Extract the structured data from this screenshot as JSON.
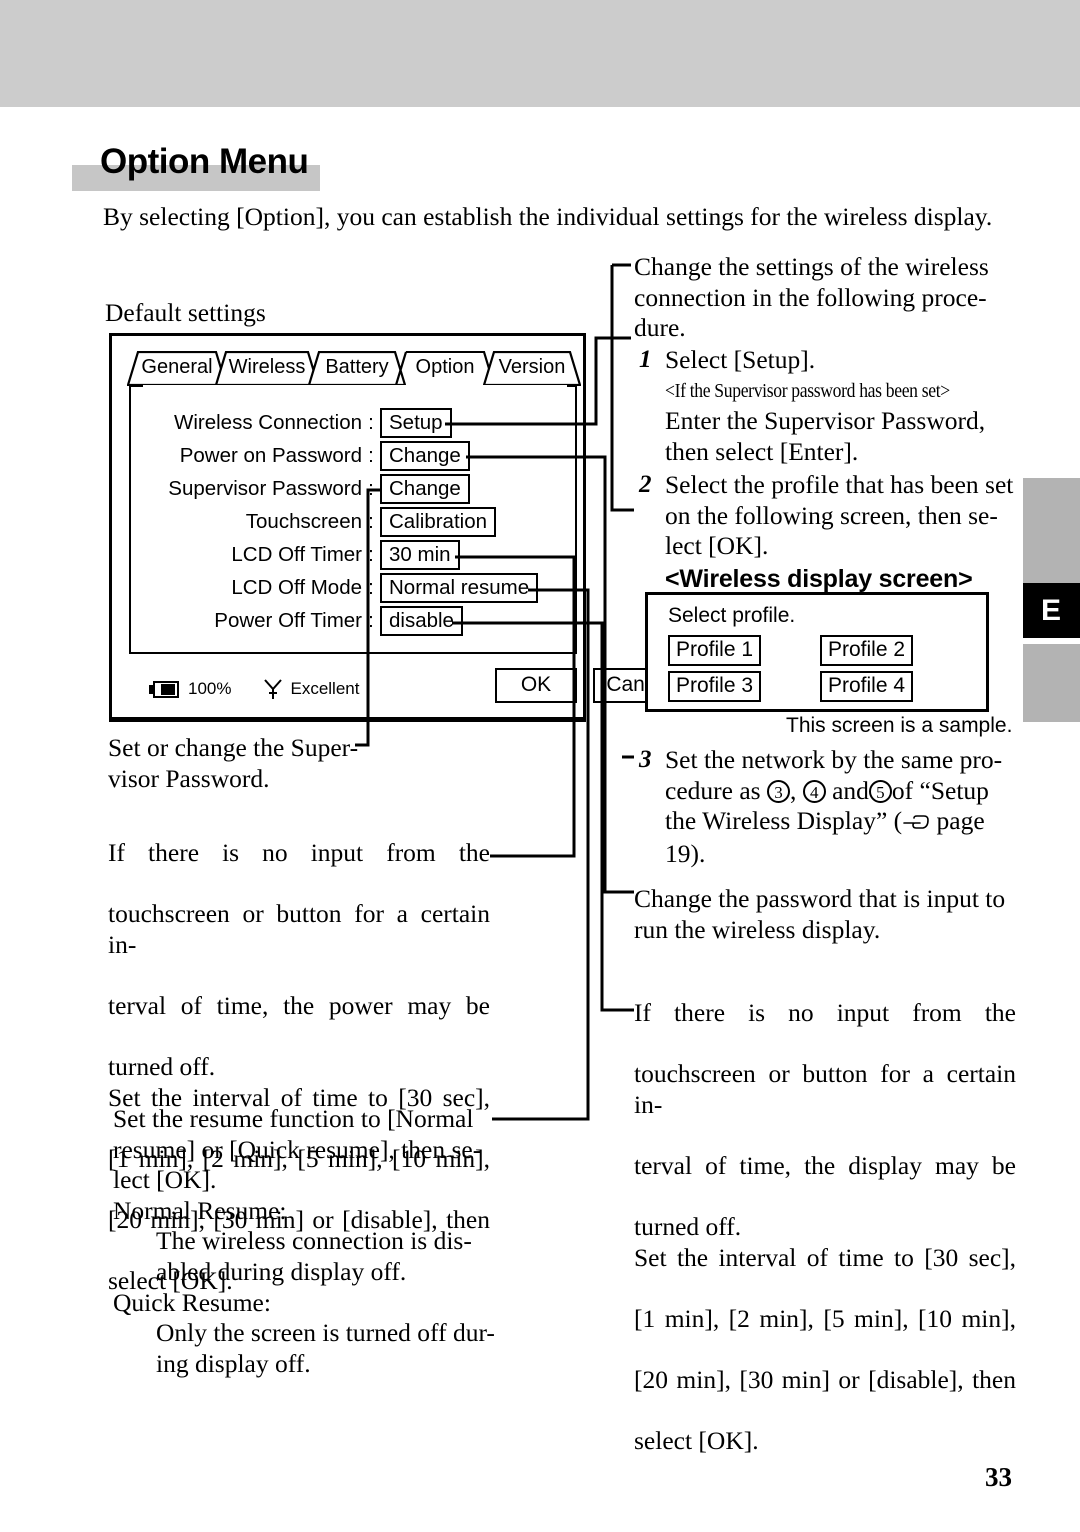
{
  "page": {
    "number": "33",
    "edge_tab_letter": "E",
    "title": "Option Menu",
    "intro": "By selecting [Option], you can establish the individual settings for the wireless display."
  },
  "left": {
    "default_settings_label": "Default settings",
    "dialog": {
      "tabs": [
        {
          "label": "General",
          "active": false
        },
        {
          "label": "Wireless",
          "active": false
        },
        {
          "label": "Battery",
          "active": false
        },
        {
          "label": "Option",
          "active": true
        },
        {
          "label": "Version",
          "active": false
        }
      ],
      "settings": [
        {
          "label": "Wireless Connection",
          "colon": ":",
          "value": "Setup"
        },
        {
          "label": "Power on Password",
          "colon": ":",
          "value": "Change"
        },
        {
          "label": "Supervisor Password",
          "colon": ":",
          "value": "Change"
        },
        {
          "label": "Touchscreen",
          "colon": ":",
          "value": "Calibration"
        },
        {
          "label": "LCD Off Timer",
          "colon": ":",
          "value": "30 min"
        },
        {
          "label": "LCD Off Mode",
          "colon": ":",
          "value": "Normal resume"
        },
        {
          "label": "Power Off Timer",
          "colon": ":",
          "value": "disable"
        }
      ],
      "status": {
        "battery_icon": "battery-icon",
        "battery_percent": "100%",
        "signal_icon": "antenna-icon",
        "signal_level": "Excellent"
      },
      "buttons": {
        "ok": "OK",
        "cancel": "Cancel"
      }
    },
    "notes": {
      "supervisor": "Set or change the Super-\nvisor Password.",
      "supervisor_l1": "Set or change the Super-",
      "supervisor_l2": "visor Password.",
      "power_off_1": "If there is no input from the",
      "power_off_2": "touchscreen or button for a certain in-",
      "power_off_3": "terval of time, the power may be",
      "power_off_4": "turned off.",
      "power_off_5": "Set the interval of time to [30 sec],",
      "power_off_6": "[1 min], [2 min], [5 min], [10 min],",
      "power_off_7": "[20 min], [30 min] or [disable], then",
      "power_off_8": "select [OK].",
      "resume_1": "Set the resume function to [Normal",
      "resume_2": "resume] or [Quick resume], then se-",
      "resume_3": "lect [OK].",
      "resume_normal_head": "Normal Resume:",
      "resume_normal_1": "The wireless connection is dis-",
      "resume_normal_2": "abled during display off.",
      "resume_quick_head": "Quick Resume:",
      "resume_quick_1": "Only the screen is turned off dur-",
      "resume_quick_2": "ing display off."
    }
  },
  "right": {
    "wireless_intro_1": "Change the settings of the wireless",
    "wireless_intro_2": "connection in the following proce-",
    "wireless_intro_3": "dure.",
    "step1": {
      "num": "1",
      "text": "Select [Setup].",
      "condition": "<If the Supervisor password has been set>",
      "sub_1": "Enter the Supervisor Password,",
      "sub_2": "then select [Enter]."
    },
    "step2": {
      "num": "2",
      "line_1": "Select the profile that has been set",
      "line_2": "on the following screen, then se-",
      "line_3": "lect [OK].",
      "heading": "<Wireless display screen>"
    },
    "profile_screen": {
      "title": "Select profile.",
      "buttons": [
        "Profile 1",
        "Profile 2",
        "Profile 3",
        "Profile 4"
      ],
      "note": "This screen is a sample."
    },
    "step3": {
      "num": "3",
      "line_1": "Set the network by the same pro-",
      "line_2_pre": "cedure as ",
      "circ_a": "3",
      "line_2_mid": ", ",
      "circ_b": "4",
      "line_2_mid2": " and",
      "circ_c": "5",
      "line_2_post": "of “Setup",
      "line_3_pre": "the Wireless Display” (",
      "pointer_icon": "pointing-hand-icon",
      "line_3_post": " page",
      "line_4": "19)."
    },
    "password_note_1": "Change the password that is input to",
    "password_note_2": "run the wireless display.",
    "display_off_1": "If there is no input from the",
    "display_off_2": "touchscreen or button for a certain in-",
    "display_off_3": "terval of time, the display may be",
    "display_off_4": "turned off.",
    "display_off_5": "Set the interval of time to [30 sec],",
    "display_off_6": "[1 min], [2 min], [5 min], [10 min],",
    "display_off_7": "[20 min], [30 min] or [disable], then",
    "display_off_8": "select [OK]."
  }
}
